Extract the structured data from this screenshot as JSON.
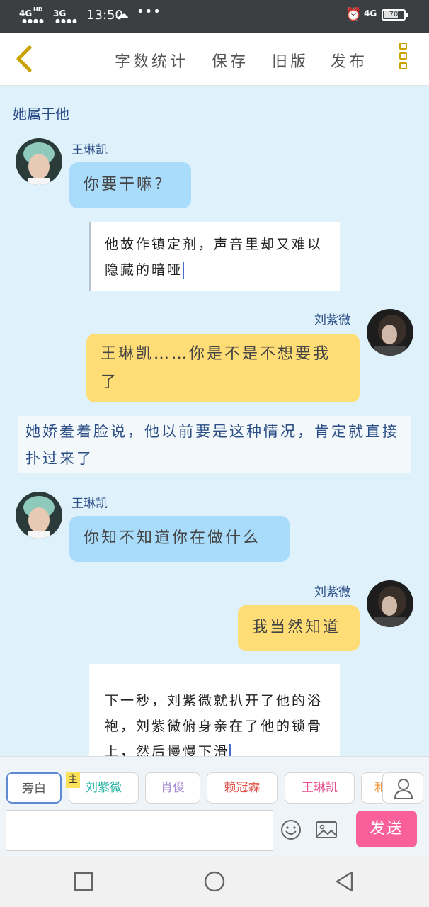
{
  "status_bar": {
    "signal1": "4G",
    "signal1_hd": "HD",
    "signal2": "3G",
    "time": "13:50",
    "more": "•••",
    "net": "4G",
    "battery": "70",
    "battery_level": 0.7
  },
  "toolbar": {
    "actions": [
      "字数统计",
      "保存",
      "旧版",
      "发布"
    ]
  },
  "story": {
    "title": "她属于他",
    "messages": [
      {
        "type": "dialogue",
        "side": "left",
        "speaker": "王琳凯",
        "text": "你要干嘛？"
      },
      {
        "type": "narration",
        "text": "他故作镇定剂，声音里却又难以隐藏的暗哑"
      },
      {
        "type": "dialogue",
        "side": "right",
        "speaker": "刘紫微",
        "text": "王琳凯……你是不是不想要我了"
      },
      {
        "type": "narration_strip",
        "text": "她娇羞着脸说，他以前要是这种情况，肯定就直接扑过来了"
      },
      {
        "type": "dialogue",
        "side": "left",
        "speaker": "王琳凯",
        "text": "你知不知道你在做什么"
      },
      {
        "type": "dialogue",
        "side": "right",
        "speaker": "刘紫微",
        "text": "我当然知道"
      },
      {
        "type": "narration",
        "text": "下一秒，刘紫微就扒开了他的浴袍，刘紫微俯身亲在了他的锁骨上，然后慢慢下滑"
      }
    ]
  },
  "composer": {
    "roles": [
      {
        "label": "旁白",
        "color": "#555555",
        "active": true
      },
      {
        "label": "刘紫微",
        "color": "#27b3a4",
        "main_tag": "主"
      },
      {
        "label": "肖俊",
        "color": "#a78bd6"
      },
      {
        "label": "赖冠霖",
        "color": "#e0524a"
      },
      {
        "label": "王琳凯",
        "color": "#e84a8c"
      },
      {
        "label": "和",
        "color": "#f0953a"
      }
    ],
    "input_value": "",
    "send_label": "发送"
  },
  "colors": {
    "accent_yellow": "#fedd76",
    "accent_blue": "#a9dbfb",
    "send_pink": "#f95f9a",
    "chat_bg": "#dff1fb"
  }
}
